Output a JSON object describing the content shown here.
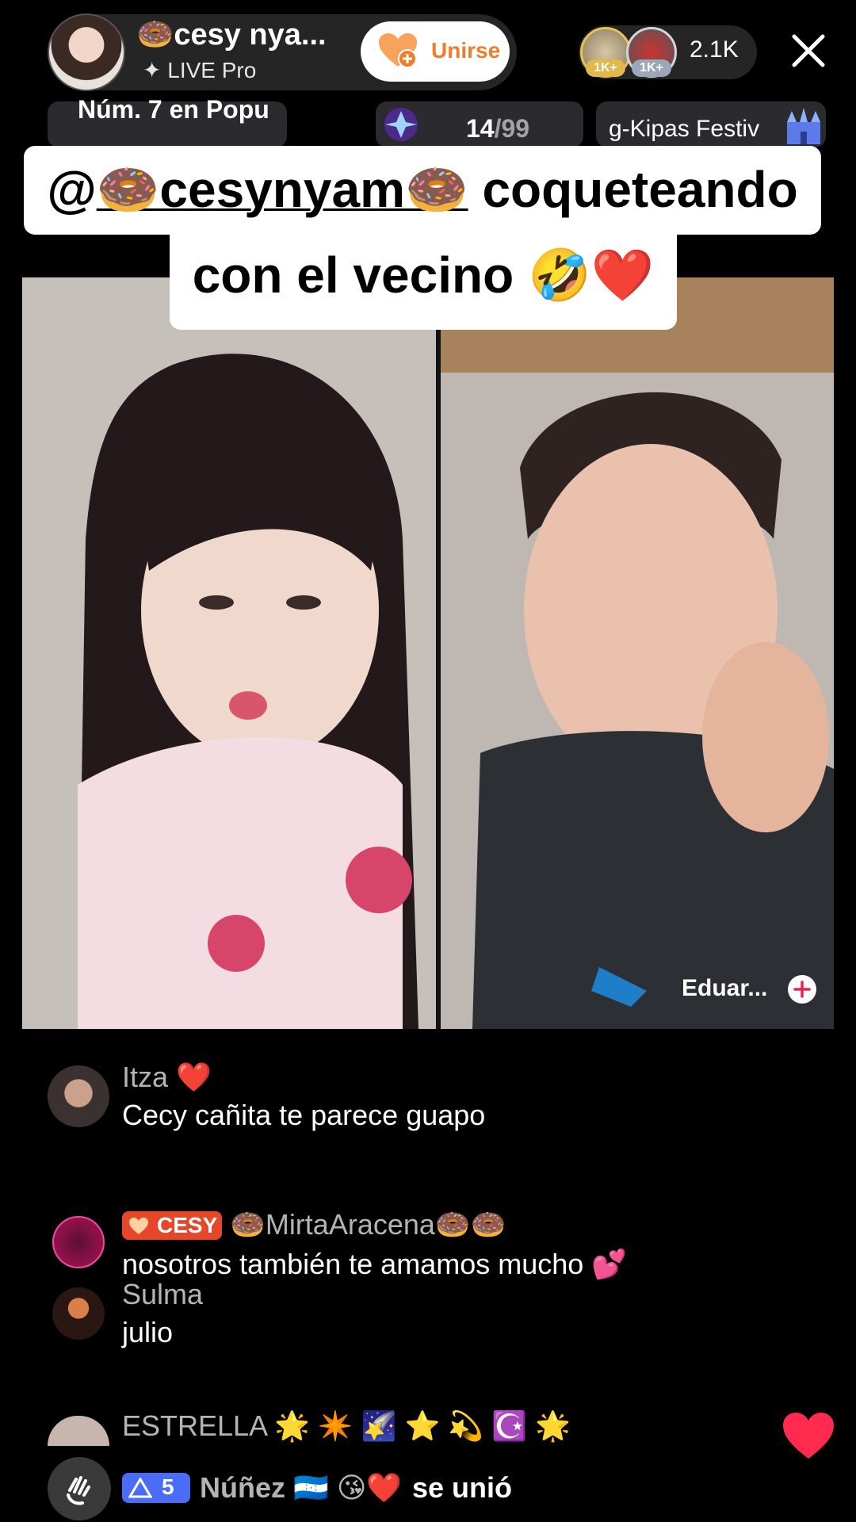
{
  "host": {
    "name": "🍩cesy nya...",
    "subtitle": "✦ LIVE Pro",
    "join_label": "Unirse"
  },
  "viewers": {
    "badges": [
      "1K+",
      "1K+"
    ],
    "count": "2.1K"
  },
  "ranking": {
    "text": "Núm. 7 en Popu",
    "counter_current": "14",
    "counter_total": "/99",
    "festival": "g-Kipas Festiv"
  },
  "caption": {
    "at": "@",
    "mention": "🍩cesynyam🍩",
    "rest_line1": " coqueteando",
    "line2": "con el vecino 🤣❤️"
  },
  "guest": {
    "name": "Eduar..."
  },
  "comments": [
    {
      "user": "Itza ❤️",
      "text": "Cecy cañita te parece guapo"
    },
    {
      "badge": "CESY",
      "user": "🍩MirtaAracena🍩🍩",
      "text": "nosotros también te amamos mucho 💕"
    },
    {
      "user": "Sulma",
      "text": "julio"
    },
    {
      "user": "ESTRELLA 🌟 ✴️ 🌠 ⭐ 💫 ☪️ 🌟",
      "text": ""
    }
  ],
  "join_notice": {
    "level": "5",
    "user": "Núñez 🇭🇳 😘❤️",
    "action": " se unió"
  },
  "colors": {
    "accent": "#f07d2a",
    "cesy_badge": "#e6472b",
    "level_badge": "#4a6cf7",
    "heart": "#ff2a4d"
  }
}
